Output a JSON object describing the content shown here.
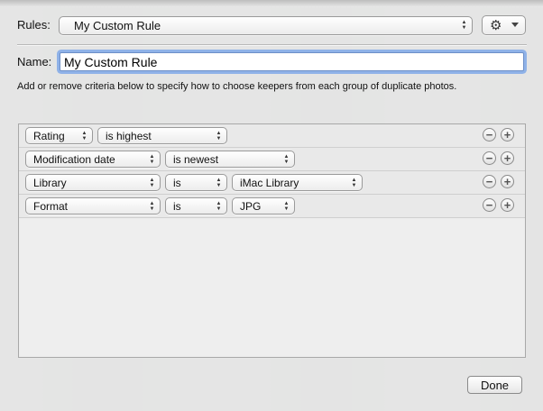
{
  "header": {
    "rules_label": "Rules:",
    "rules_value": "My Custom Rule"
  },
  "name": {
    "label": "Name:",
    "value": "My Custom Rule"
  },
  "description": "Add or remove criteria below to specify how to choose keepers from each group of duplicate photos.",
  "criteria": [
    {
      "field": "Rating",
      "operator": "is highest",
      "value": null
    },
    {
      "field": "Modification date",
      "operator": "is newest",
      "value": null
    },
    {
      "field": "Library",
      "operator": "is",
      "value": "iMac Library"
    },
    {
      "field": "Format",
      "operator": "is",
      "value": "JPG"
    }
  ],
  "footer": {
    "done_label": "Done"
  },
  "icons": {
    "gear": "gear-icon",
    "remove": "minus-circle-icon",
    "add": "plus-circle-icon"
  }
}
